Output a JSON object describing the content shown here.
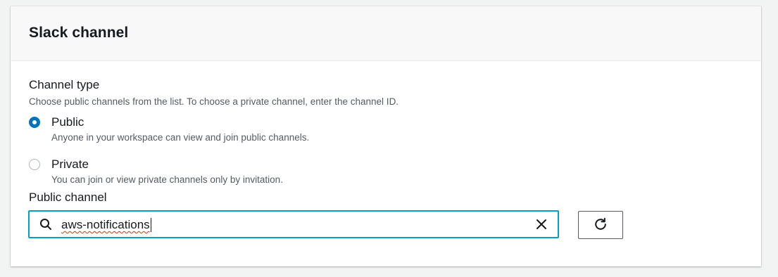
{
  "panel": {
    "title": "Slack channel"
  },
  "channel_type": {
    "label": "Channel type",
    "description": "Choose public channels from the list. To choose a private channel, enter the channel ID.",
    "selected": "public",
    "options": [
      {
        "label": "Public",
        "description": "Anyone in your workspace can view and join public channels.",
        "checked": true
      },
      {
        "label": "Private",
        "description": "You can join or view private channels only by invitation.",
        "checked": false
      }
    ]
  },
  "public_channel": {
    "label": "Public channel",
    "value": "aws-notifications",
    "search_icon": "search-icon",
    "clear_icon": "close-icon",
    "refresh_icon": "refresh-icon"
  },
  "colors": {
    "accent": "#0073bb",
    "focus_border": "#00a1c9",
    "text": "#16191f",
    "secondary_text": "#545b64",
    "background": "#f2f3f3"
  }
}
